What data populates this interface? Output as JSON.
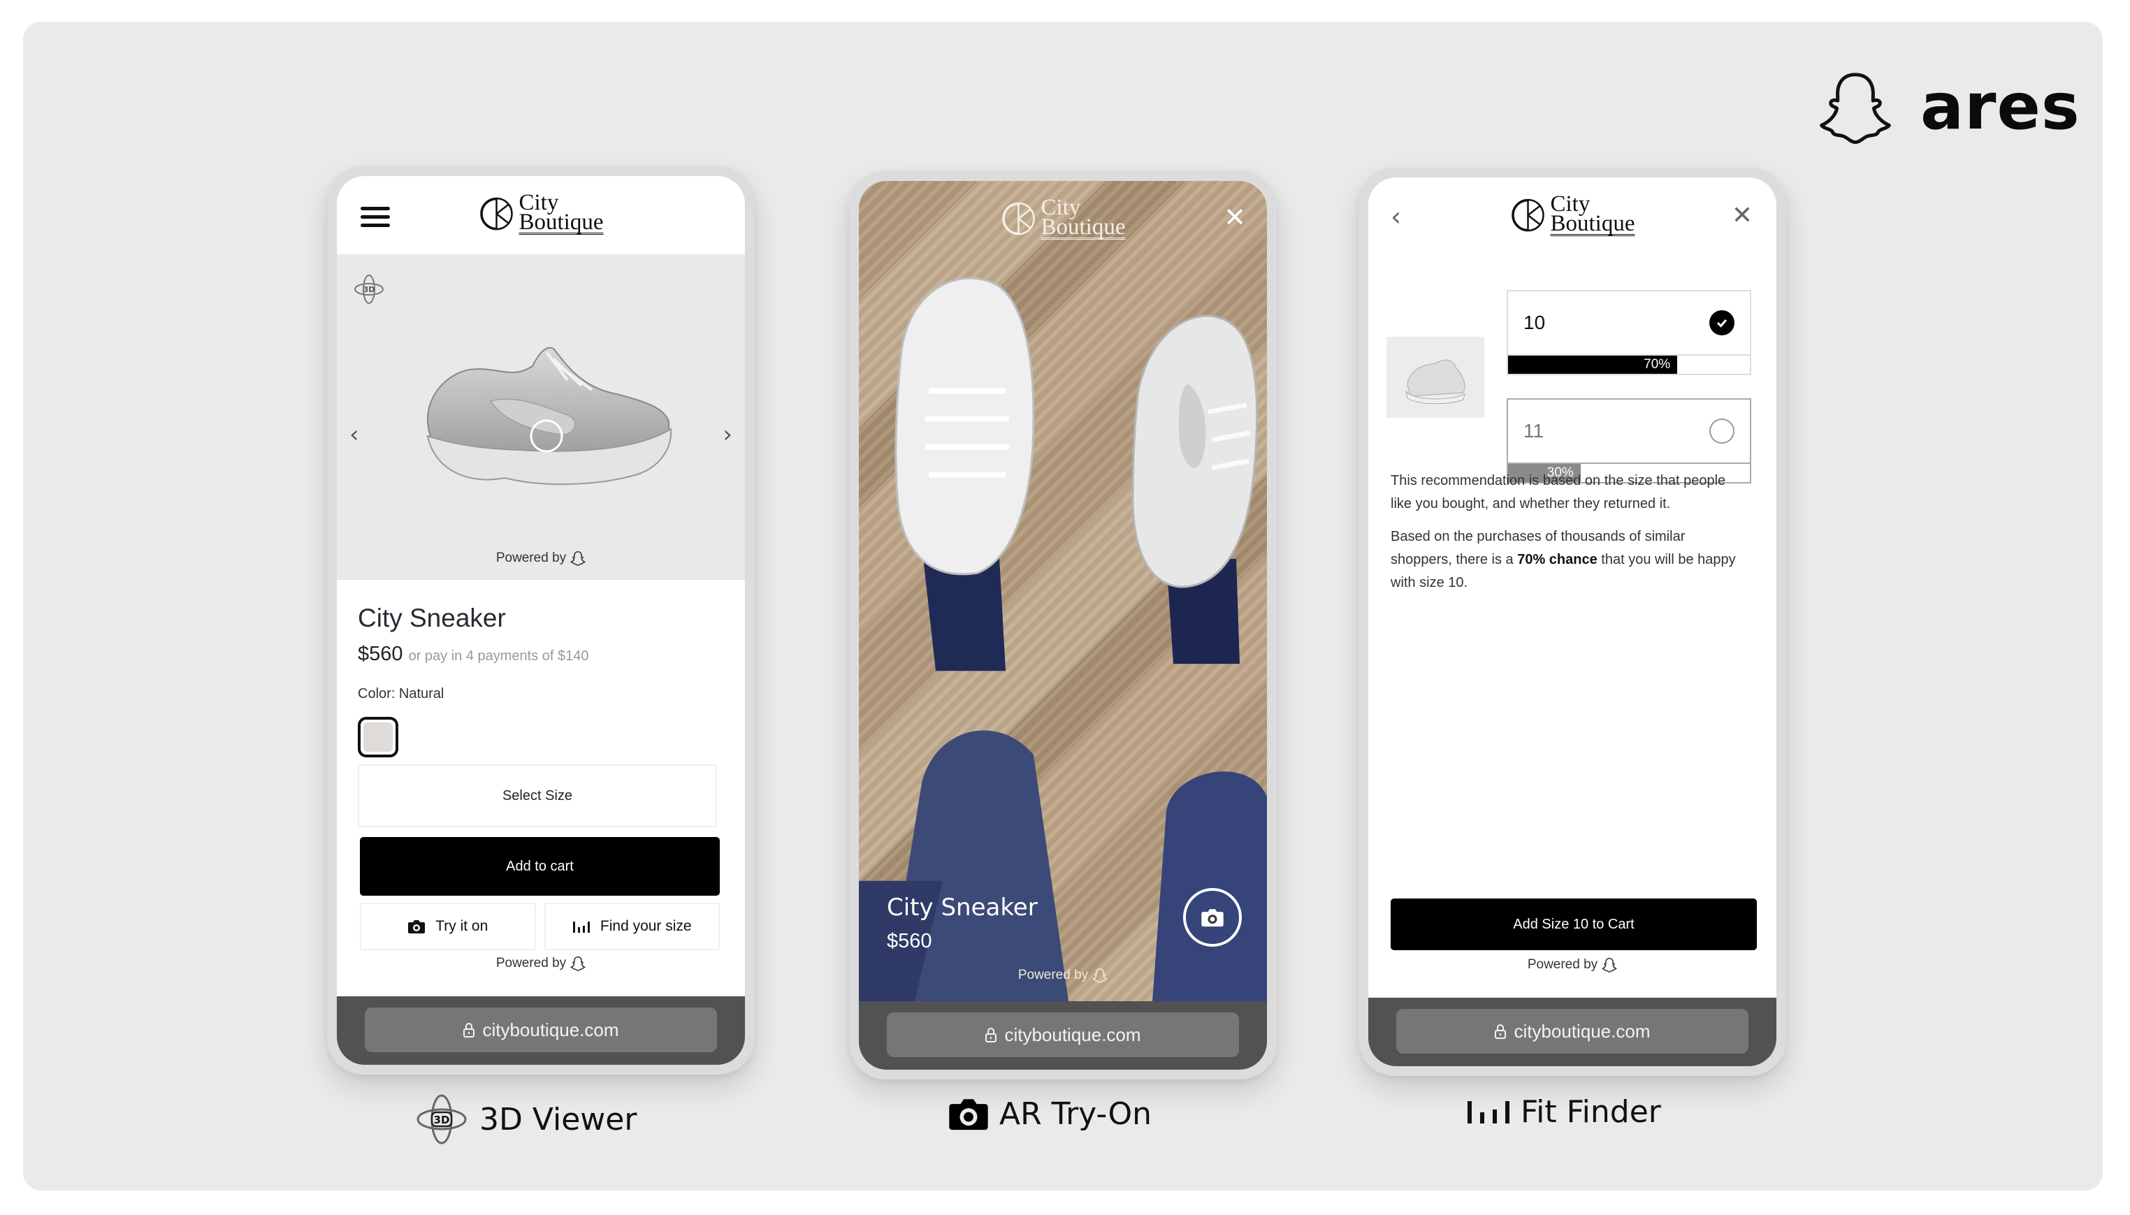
{
  "brand": {
    "name": "ares",
    "icon": "snapchat-ghost-icon"
  },
  "store": {
    "logo_line1": "City",
    "logo_line2": "Boutique",
    "url": "cityboutique.com"
  },
  "powered_by": "Powered by",
  "viewer_phone": {
    "badge": "3D",
    "product_name": "City Sneaker",
    "price": "$560",
    "installments": "or pay in 4 payments of $140",
    "color_label": "Color: Natural",
    "swatch_color": "#dedbd8",
    "select_size": "Select Size",
    "add_to_cart": "Add to cart",
    "try_it_on": "Try it on",
    "find_your_size": "Find your size",
    "caption": "3D Viewer"
  },
  "ar_phone": {
    "product_name": "City Sneaker",
    "price": "$560",
    "caption": "AR Try-On"
  },
  "fit_phone": {
    "options": [
      {
        "size": "10",
        "percent": 70,
        "percent_label": "70%",
        "selected": true,
        "bar_color": "#000000"
      },
      {
        "size": "11",
        "percent": 30,
        "percent_label": "30%",
        "selected": false,
        "bar_color": "#8a8a8a"
      }
    ],
    "explanation_1": "This recommendation is based on the size that people like you bought, and whether they returned it.",
    "explanation_2_pre": "Based on the purchases of thousands of similar shoppers, there is a ",
    "explanation_2_bold": "70% chance",
    "explanation_2_post": " that you will be happy with size 10.",
    "add_button": "Add Size 10 to Cart",
    "caption": "Fit Finder"
  }
}
